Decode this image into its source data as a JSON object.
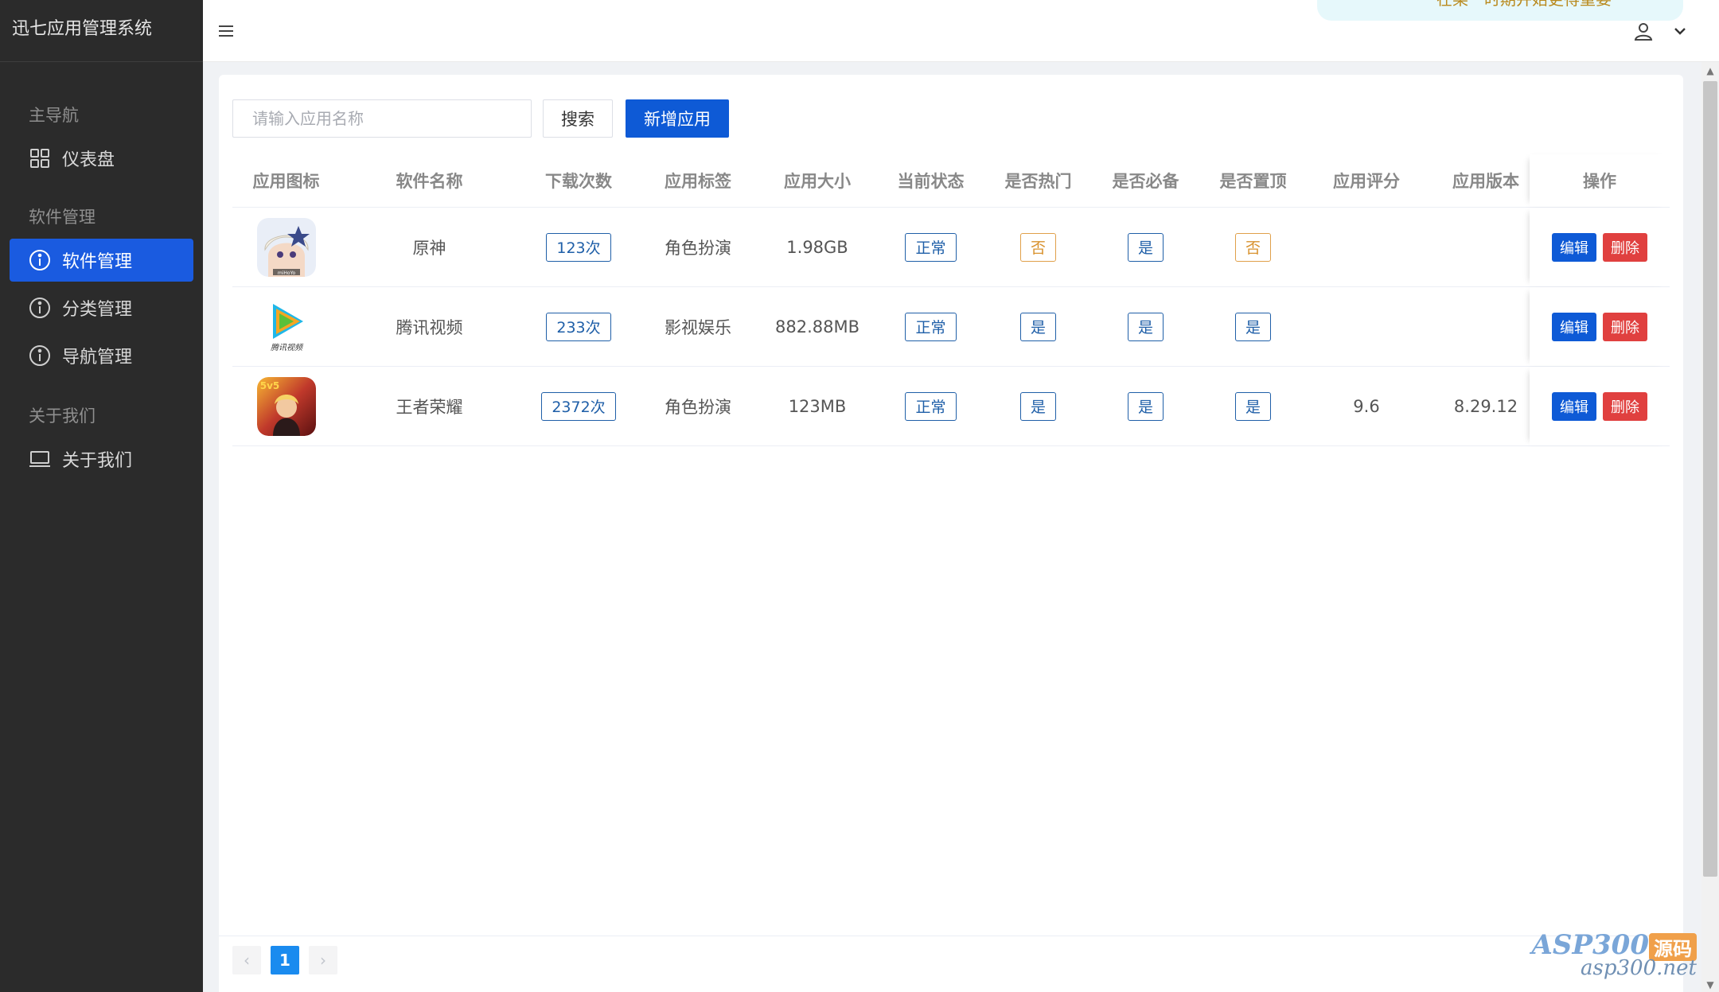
{
  "app": {
    "title": "迅七应用管理系统"
  },
  "header": {
    "notice": "在某一时期并始更得重要"
  },
  "sidebar": {
    "groups": [
      {
        "label": "主导航",
        "items": [
          {
            "label": "仪表盘",
            "icon": "grid-icon"
          }
        ]
      },
      {
        "label": "软件管理",
        "items": [
          {
            "label": "软件管理",
            "icon": "info-icon",
            "active": true
          },
          {
            "label": "分类管理",
            "icon": "info-icon"
          },
          {
            "label": "导航管理",
            "icon": "info-icon"
          }
        ]
      },
      {
        "label": "关于我们",
        "items": [
          {
            "label": "关于我们",
            "icon": "laptop-icon"
          }
        ]
      }
    ]
  },
  "toolbar": {
    "search_placeholder": "请输入应用名称",
    "search_label": "搜索",
    "add_label": "新增应用"
  },
  "table": {
    "columns": [
      "应用图标",
      "软件名称",
      "下载次数",
      "应用标签",
      "应用大小",
      "当前状态",
      "是否热门",
      "是否必备",
      "是否置顶",
      "应用评分",
      "应用版本",
      "操作"
    ],
    "rows": [
      {
        "name": "原神",
        "downloads": "123次",
        "tag": "角色扮演",
        "size": "1.98GB",
        "status": "正常",
        "hot": "否",
        "essential": "是",
        "top": "否",
        "rating": "",
        "version": "",
        "edit": "编辑",
        "delete": "删除",
        "icon_caption": "miHoYo"
      },
      {
        "name": "腾讯视频",
        "downloads": "233次",
        "tag": "影视娱乐",
        "size": "882.88MB",
        "status": "正常",
        "hot": "是",
        "essential": "是",
        "top": "是",
        "rating": "",
        "version": "",
        "edit": "编辑",
        "delete": "删除",
        "icon_caption": "腾讯视频"
      },
      {
        "name": "王者荣耀",
        "downloads": "2372次",
        "tag": "角色扮演",
        "size": "123MB",
        "status": "正常",
        "hot": "是",
        "essential": "是",
        "top": "是",
        "rating": "9.6",
        "version": "8.29.12",
        "edit": "编辑",
        "delete": "删除",
        "icon_caption": "5v5"
      }
    ]
  },
  "pagination": {
    "current": "1",
    "prev": "‹",
    "next": "›"
  },
  "watermark": {
    "line1": "ASP300",
    "badge": "源码",
    "line2": "asp300.net"
  },
  "colors": {
    "primary": "#0e5ad6",
    "danger": "#e0403f",
    "sidebar_bg": "#2b2b2b",
    "warn": "#d8922e"
  }
}
